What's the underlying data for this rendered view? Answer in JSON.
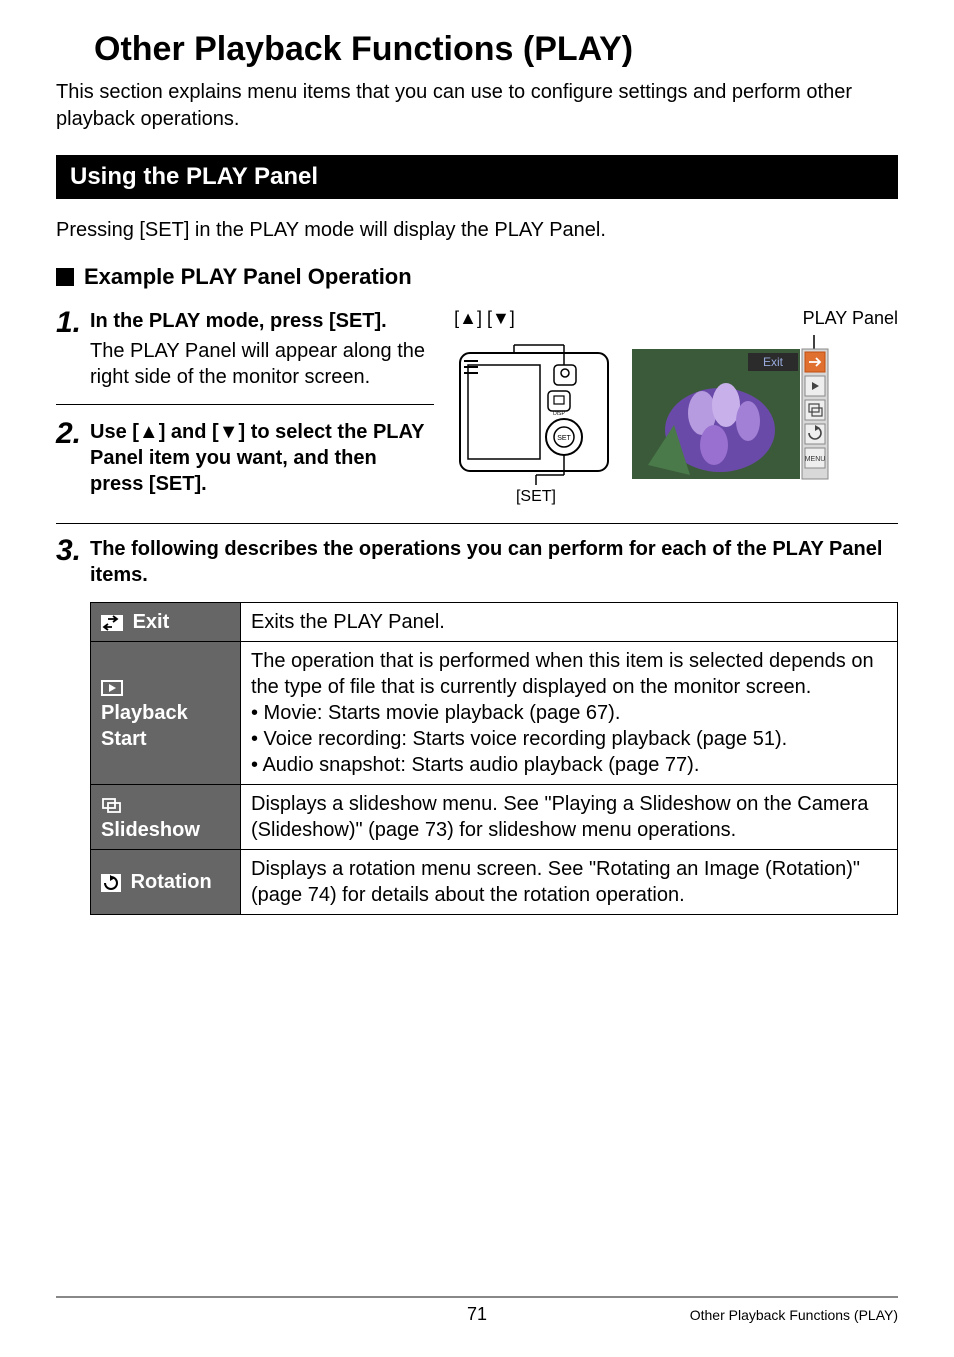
{
  "title": "Other Playback Functions (PLAY)",
  "intro": "This section explains menu items that you can use to configure settings and perform other playback operations.",
  "section_bar": "Using the PLAY Panel",
  "sub_intro": "Pressing [SET] in the PLAY mode will display the PLAY Panel.",
  "subhead": "Example PLAY Panel Operation",
  "steps": {
    "s1": {
      "num": "1.",
      "title": "In the PLAY mode, press [SET].",
      "desc": "The PLAY Panel will appear along the right side of the monitor screen."
    },
    "s2": {
      "num": "2.",
      "title": "Use [▲] and [▼] to select the PLAY Panel item you want, and then press [SET]."
    },
    "s3": {
      "num": "3.",
      "title": "The following describes the operations you can perform for each of the PLAY Panel items."
    }
  },
  "diagram": {
    "arrows_label": "[▲] [▼]",
    "play_panel_label": "PLAY Panel",
    "set_label": "[SET]",
    "screen_text": "Exit"
  },
  "table": {
    "exit": {
      "label": "Exit",
      "desc": "Exits the PLAY Panel."
    },
    "playback": {
      "label_line1": "Playback",
      "label_line2": "Start",
      "desc_intro": "The operation that is performed when this item is selected depends on the type of file that is currently displayed on the monitor screen.",
      "bullets": [
        "• Movie: Starts movie playback (page 67).",
        "• Voice recording: Starts voice recording playback (page 51).",
        "• Audio snapshot: Starts audio playback (page 77)."
      ]
    },
    "slideshow": {
      "label": "Slideshow",
      "desc": "Displays a slideshow menu. See \"Playing a Slideshow on the Camera (Slideshow)\" (page 73) for slideshow menu operations."
    },
    "rotation": {
      "label": "Rotation",
      "desc": "Displays a rotation menu screen. See \"Rotating an Image (Rotation)\" (page 74) for details about the rotation operation."
    }
  },
  "footer": {
    "page": "71",
    "title": "Other Playback Functions (PLAY)"
  }
}
